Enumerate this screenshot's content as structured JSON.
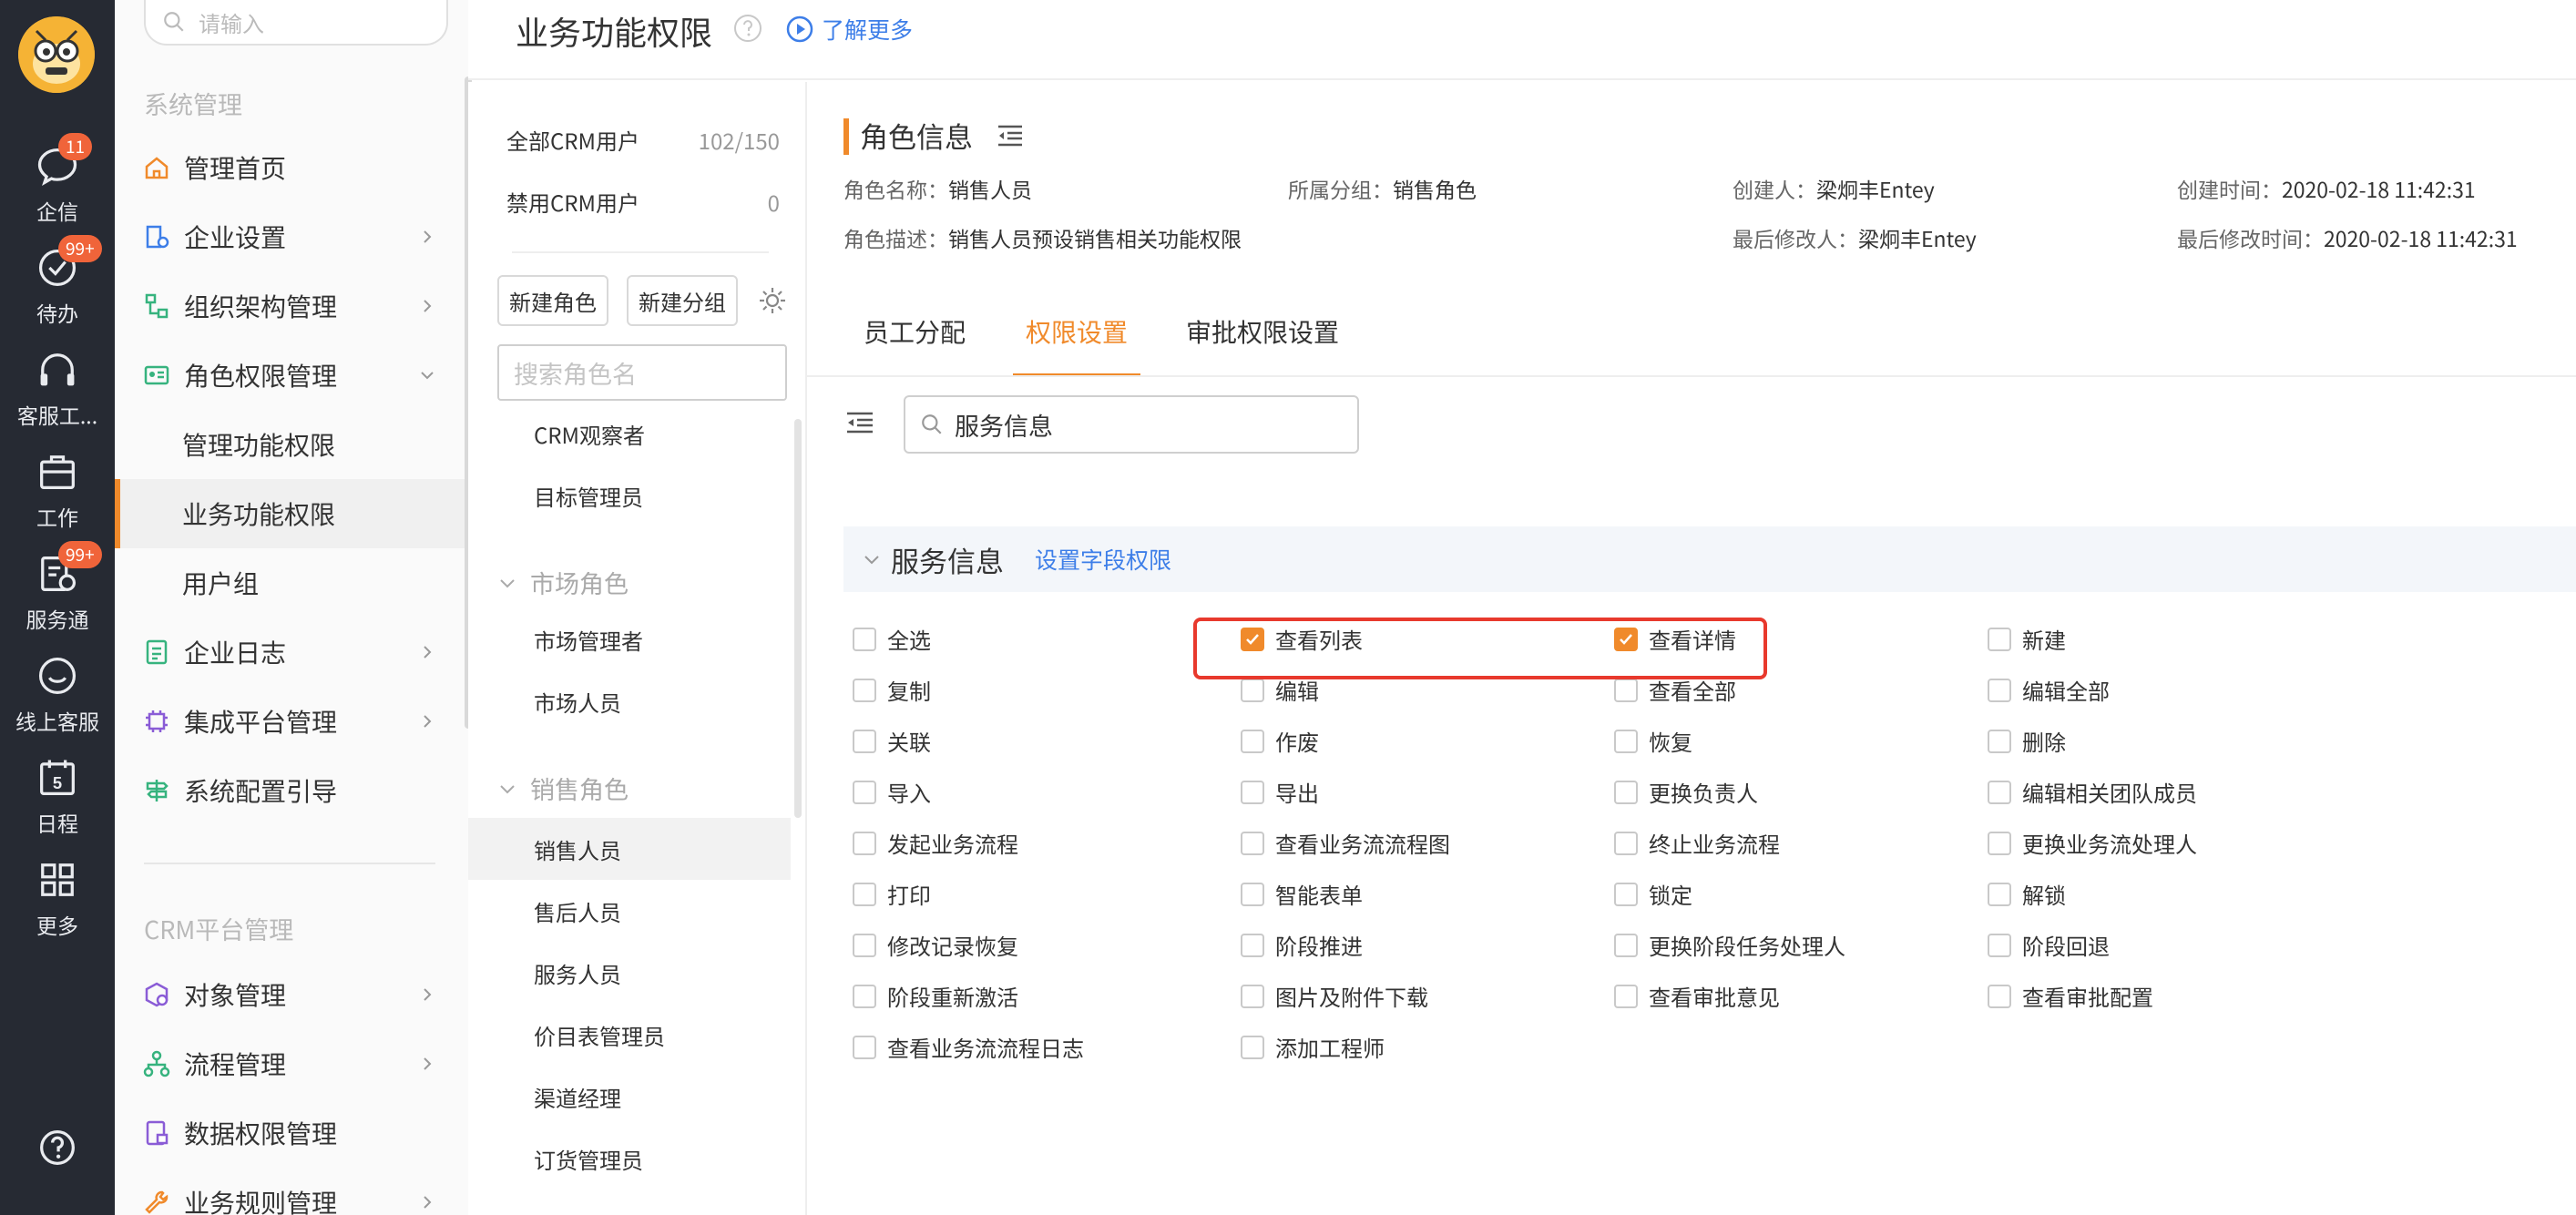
{
  "rail": {
    "items": [
      {
        "label": "企信",
        "badge": "11"
      },
      {
        "label": "待办",
        "badge": "99+"
      },
      {
        "label": "客服工...",
        "badge": ""
      },
      {
        "label": "工作",
        "badge": ""
      },
      {
        "label": "服务通",
        "badge": "99+"
      },
      {
        "label": "线上客服",
        "badge": ""
      },
      {
        "label": "日程",
        "badge": ""
      },
      {
        "label": "更多",
        "badge": ""
      }
    ],
    "calendar_day": "5"
  },
  "nav": {
    "search_placeholder": "请输入",
    "section_system": "系统管理",
    "section_crm": "CRM平台管理",
    "items": [
      {
        "label": "管理首页"
      },
      {
        "label": "企业设置"
      },
      {
        "label": "组织架构管理"
      },
      {
        "label": "角色权限管理"
      },
      {
        "label": "管理功能权限"
      },
      {
        "label": "业务功能权限"
      },
      {
        "label": "用户组"
      },
      {
        "label": "企业日志"
      },
      {
        "label": "集成平台管理"
      },
      {
        "label": "系统配置引导"
      },
      {
        "label": "对象管理"
      },
      {
        "label": "流程管理"
      },
      {
        "label": "数据权限管理"
      },
      {
        "label": "业务规则管理"
      }
    ]
  },
  "header": {
    "title": "业务功能权限",
    "learn_more": "了解更多"
  },
  "roles": {
    "stats": [
      {
        "label": "全部CRM用户",
        "value": "102/150"
      },
      {
        "label": "禁用CRM用户",
        "value": "0"
      }
    ],
    "new_role_button": "新建角色",
    "new_group_button": "新建分组",
    "search_placeholder": "搜索角色名",
    "ungrouped": [
      "CRM观察者",
      "目标管理员"
    ],
    "groups": [
      {
        "title": "市场角色",
        "items": [
          "市场管理者",
          "市场人员"
        ]
      },
      {
        "title": "销售角色",
        "items": [
          "销售人员",
          "售后人员",
          "服务人员",
          "价目表管理员",
          "渠道经理",
          "订货管理员"
        ]
      }
    ],
    "selected": "销售人员"
  },
  "role_info": {
    "title": "角色信息",
    "fields": [
      {
        "key": "角色名称：",
        "value": "销售人员"
      },
      {
        "key": "所属分组：",
        "value": "销售角色"
      },
      {
        "key": "创建人：",
        "value": "梁炯丰Entey"
      },
      {
        "key": "创建时间：",
        "value": "2020-02-18 11:42:31"
      },
      {
        "key": "角色描述：",
        "value": "销售人员预设销售相关功能权限"
      },
      {
        "key": "最后修改人：",
        "value": "梁炯丰Entey"
      },
      {
        "key": "最后修改时间：",
        "value": "2020-02-18 11:42:31"
      }
    ]
  },
  "tabs": [
    {
      "label": "员工分配",
      "active": false
    },
    {
      "label": "权限设置",
      "active": true
    },
    {
      "label": "审批权限设置",
      "active": false
    }
  ],
  "permissions": {
    "search_value": "服务信息",
    "section_title": "服务信息",
    "section_link": "设置字段权限",
    "items": [
      {
        "label": "全选",
        "checked": false
      },
      {
        "label": "查看列表",
        "checked": true
      },
      {
        "label": "查看详情",
        "checked": true
      },
      {
        "label": "新建",
        "checked": false
      },
      {
        "label": "复制",
        "checked": false
      },
      {
        "label": "编辑",
        "checked": false
      },
      {
        "label": "查看全部",
        "checked": false
      },
      {
        "label": "编辑全部",
        "checked": false
      },
      {
        "label": "关联",
        "checked": false
      },
      {
        "label": "作废",
        "checked": false
      },
      {
        "label": "恢复",
        "checked": false
      },
      {
        "label": "删除",
        "checked": false
      },
      {
        "label": "导入",
        "checked": false
      },
      {
        "label": "导出",
        "checked": false
      },
      {
        "label": "更换负责人",
        "checked": false
      },
      {
        "label": "编辑相关团队成员",
        "checked": false
      },
      {
        "label": "发起业务流程",
        "checked": false
      },
      {
        "label": "查看业务流流程图",
        "checked": false
      },
      {
        "label": "终止业务流程",
        "checked": false
      },
      {
        "label": "更换业务流处理人",
        "checked": false
      },
      {
        "label": "打印",
        "checked": false
      },
      {
        "label": "智能表单",
        "checked": false
      },
      {
        "label": "锁定",
        "checked": false
      },
      {
        "label": "解锁",
        "checked": false
      },
      {
        "label": "修改记录恢复",
        "checked": false
      },
      {
        "label": "阶段推进",
        "checked": false
      },
      {
        "label": "更换阶段任务处理人",
        "checked": false
      },
      {
        "label": "阶段回退",
        "checked": false
      },
      {
        "label": "阶段重新激活",
        "checked": false
      },
      {
        "label": "图片及附件下载",
        "checked": false
      },
      {
        "label": "查看审批意见",
        "checked": false
      },
      {
        "label": "查看审批配置",
        "checked": false
      },
      {
        "label": "查看业务流流程日志",
        "checked": false
      },
      {
        "label": "添加工程师",
        "checked": false
      }
    ]
  },
  "colors": {
    "rail_bg": "#262a33",
    "accent": "#f08a2b",
    "link": "#3d7ee8",
    "badge": "#f0643a",
    "highlight": "#e8392d"
  }
}
